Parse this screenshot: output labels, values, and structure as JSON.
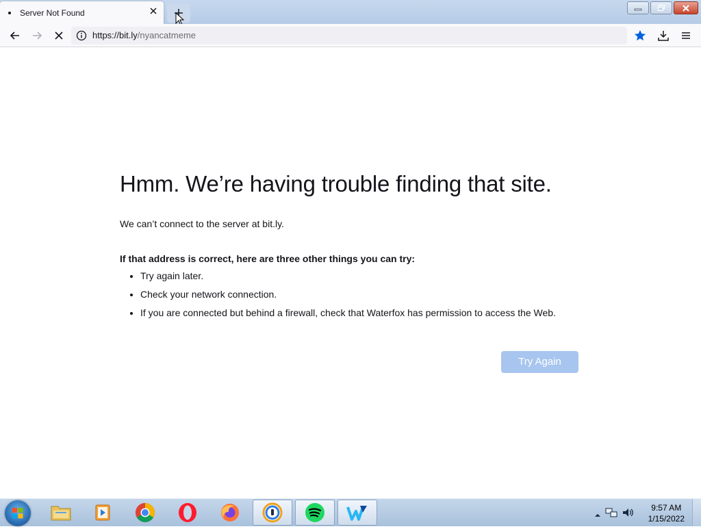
{
  "window": {
    "tab_title": "Server Not Found",
    "url_host": "https://bit.ly",
    "url_path": "/nyancatmeme"
  },
  "error_page": {
    "heading": "Hmm. We’re having trouble finding that site.",
    "message": "We can’t connect to the server at bit.ly.",
    "tips_heading": "If that address is correct, here are three other things you can try:",
    "tips": [
      "Try again later.",
      "Check your network connection.",
      "If you are connected but behind a firewall, check that Waterfox has permission to access the Web."
    ],
    "try_again_label": "Try Again"
  },
  "taskbar": {
    "pinned": [
      "file-explorer",
      "media-player",
      "chrome",
      "opera",
      "firefox",
      "avast-secure-browser",
      "spotify",
      "waterfox"
    ],
    "time": "9:57 AM",
    "date": "1/15/2022"
  },
  "colors": {
    "accent_blue": "#0061e0",
    "button_disabled": "#a7c5ee"
  }
}
